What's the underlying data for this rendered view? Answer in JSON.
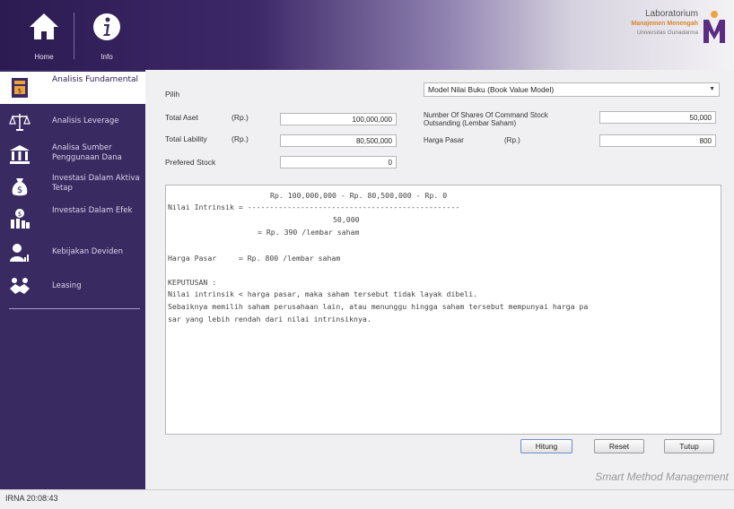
{
  "header": {
    "home_label": "Home",
    "info_label": "Info",
    "lab_line1": "Laboratorium",
    "lab_line2": "Manajemen Menengah",
    "lab_line3": "Universitas Gunadarma"
  },
  "sidebar": {
    "items": [
      {
        "label": "Analisis Fundamental",
        "icon": "ledger-icon",
        "active": true
      },
      {
        "label": "Analisis Leverage",
        "icon": "scales-icon"
      },
      {
        "label": "Analisa Sumber Penggunaan Dana",
        "icon": "bank-icon"
      },
      {
        "label": "Investasi Dalam Aktiva Tetap",
        "icon": "moneybag-icon"
      },
      {
        "label": "Investasi Dalam Efek",
        "icon": "building-coin-icon"
      },
      {
        "label": "Kebijakan Deviden",
        "icon": "user-chart-icon"
      },
      {
        "label": "Leasing",
        "icon": "handshake-icon"
      }
    ]
  },
  "form": {
    "pilih_label": "Pilih",
    "model_selected": "Model Nilai Buku (Book Value Model)",
    "total_aset_label": "Total Aset",
    "total_aset_unit": "(Rp.)",
    "total_aset_value": "100,000,000",
    "total_liability_label": "Total Lability",
    "total_liability_unit": "(Rp.)",
    "total_liability_value": "80,500,000",
    "prefered_stock_label": "Prefered Stock",
    "prefered_stock_value": "0",
    "shares_label_line1": "Number Of Shares Of Command Stock",
    "shares_label_line2": "Outsanding (Lembar Saham)",
    "shares_value": "50,000",
    "harga_pasar_label": "Harga Pasar",
    "harga_pasar_unit": "(Rp.)",
    "harga_pasar_value": "800"
  },
  "output": {
    "line1": "Rp. 100,000,000 - Rp. 80,500,000 - Rp. 0",
    "line2": "Nilai Intrinsik = ------------------------------------------------",
    "line3": "50,000",
    "line4": "= Rp. 390 /lembar saham",
    "line5": "Harga Pasar     = Rp. 800 /lembar saham",
    "line6": "KEPUTUSAN :",
    "line7": "Nilai intrinsik < harga pasar, maka saham tersebut tidak layak dibeli.",
    "line8": "Sebaiknya memilih saham perusahaan lain, atau menunggu hingga saham tersebut mempunyai harga pa",
    "line9": "sar yang lebih rendah dari nilai intrinsiknya."
  },
  "buttons": {
    "hitung": "Hitung",
    "reset": "Reset",
    "tutup": "Tutup"
  },
  "brand": "Smart Method Management",
  "status": "IRNA  20:08:43",
  "colors": {
    "sidebar": "#3a2a62",
    "header_dark": "#2c1b52",
    "logo_orange": "#f0a23a",
    "logo_purple": "#5a2d82"
  }
}
